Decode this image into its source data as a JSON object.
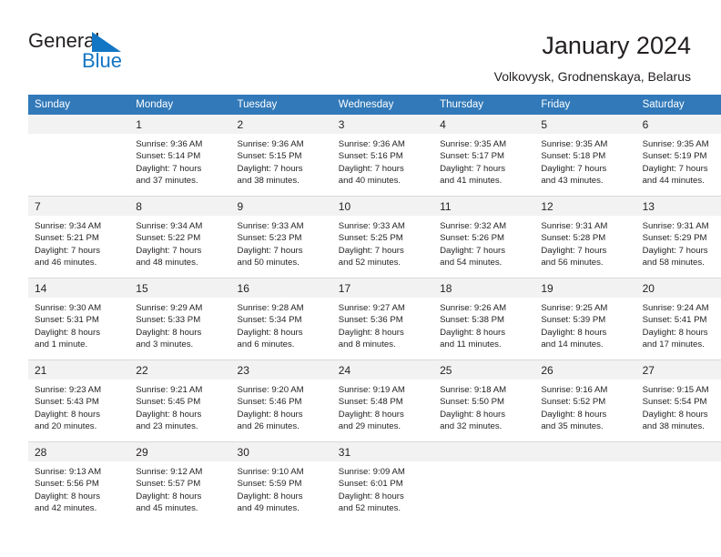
{
  "brand": {
    "name_part1": "General",
    "name_part2": "Blue",
    "logo_icon": "triangle-sail-icon",
    "accent_color": "#1376c4"
  },
  "header": {
    "title": "January 2024",
    "subtitle": "Volkovysk, Grodnenskaya, Belarus"
  },
  "colors": {
    "header_row_bg": "#3179b9",
    "daynum_bg": "#f2f2f2",
    "grid_line": "#d9d9d9",
    "text": "#231f20"
  },
  "weekday_headers": [
    "Sunday",
    "Monday",
    "Tuesday",
    "Wednesday",
    "Thursday",
    "Friday",
    "Saturday"
  ],
  "weeks": [
    [
      {
        "day": "",
        "empty": true,
        "sunrise": "",
        "sunset": "",
        "daylight_line1": "",
        "daylight_line2": ""
      },
      {
        "day": "1",
        "empty": false,
        "sunrise": "Sunrise: 9:36 AM",
        "sunset": "Sunset: 5:14 PM",
        "daylight_line1": "Daylight: 7 hours",
        "daylight_line2": "and 37 minutes."
      },
      {
        "day": "2",
        "empty": false,
        "sunrise": "Sunrise: 9:36 AM",
        "sunset": "Sunset: 5:15 PM",
        "daylight_line1": "Daylight: 7 hours",
        "daylight_line2": "and 38 minutes."
      },
      {
        "day": "3",
        "empty": false,
        "sunrise": "Sunrise: 9:36 AM",
        "sunset": "Sunset: 5:16 PM",
        "daylight_line1": "Daylight: 7 hours",
        "daylight_line2": "and 40 minutes."
      },
      {
        "day": "4",
        "empty": false,
        "sunrise": "Sunrise: 9:35 AM",
        "sunset": "Sunset: 5:17 PM",
        "daylight_line1": "Daylight: 7 hours",
        "daylight_line2": "and 41 minutes."
      },
      {
        "day": "5",
        "empty": false,
        "sunrise": "Sunrise: 9:35 AM",
        "sunset": "Sunset: 5:18 PM",
        "daylight_line1": "Daylight: 7 hours",
        "daylight_line2": "and 43 minutes."
      },
      {
        "day": "6",
        "empty": false,
        "sunrise": "Sunrise: 9:35 AM",
        "sunset": "Sunset: 5:19 PM",
        "daylight_line1": "Daylight: 7 hours",
        "daylight_line2": "and 44 minutes."
      }
    ],
    [
      {
        "day": "7",
        "empty": false,
        "sunrise": "Sunrise: 9:34 AM",
        "sunset": "Sunset: 5:21 PM",
        "daylight_line1": "Daylight: 7 hours",
        "daylight_line2": "and 46 minutes."
      },
      {
        "day": "8",
        "empty": false,
        "sunrise": "Sunrise: 9:34 AM",
        "sunset": "Sunset: 5:22 PM",
        "daylight_line1": "Daylight: 7 hours",
        "daylight_line2": "and 48 minutes."
      },
      {
        "day": "9",
        "empty": false,
        "sunrise": "Sunrise: 9:33 AM",
        "sunset": "Sunset: 5:23 PM",
        "daylight_line1": "Daylight: 7 hours",
        "daylight_line2": "and 50 minutes."
      },
      {
        "day": "10",
        "empty": false,
        "sunrise": "Sunrise: 9:33 AM",
        "sunset": "Sunset: 5:25 PM",
        "daylight_line1": "Daylight: 7 hours",
        "daylight_line2": "and 52 minutes."
      },
      {
        "day": "11",
        "empty": false,
        "sunrise": "Sunrise: 9:32 AM",
        "sunset": "Sunset: 5:26 PM",
        "daylight_line1": "Daylight: 7 hours",
        "daylight_line2": "and 54 minutes."
      },
      {
        "day": "12",
        "empty": false,
        "sunrise": "Sunrise: 9:31 AM",
        "sunset": "Sunset: 5:28 PM",
        "daylight_line1": "Daylight: 7 hours",
        "daylight_line2": "and 56 minutes."
      },
      {
        "day": "13",
        "empty": false,
        "sunrise": "Sunrise: 9:31 AM",
        "sunset": "Sunset: 5:29 PM",
        "daylight_line1": "Daylight: 7 hours",
        "daylight_line2": "and 58 minutes."
      }
    ],
    [
      {
        "day": "14",
        "empty": false,
        "sunrise": "Sunrise: 9:30 AM",
        "sunset": "Sunset: 5:31 PM",
        "daylight_line1": "Daylight: 8 hours",
        "daylight_line2": "and 1 minute."
      },
      {
        "day": "15",
        "empty": false,
        "sunrise": "Sunrise: 9:29 AM",
        "sunset": "Sunset: 5:33 PM",
        "daylight_line1": "Daylight: 8 hours",
        "daylight_line2": "and 3 minutes."
      },
      {
        "day": "16",
        "empty": false,
        "sunrise": "Sunrise: 9:28 AM",
        "sunset": "Sunset: 5:34 PM",
        "daylight_line1": "Daylight: 8 hours",
        "daylight_line2": "and 6 minutes."
      },
      {
        "day": "17",
        "empty": false,
        "sunrise": "Sunrise: 9:27 AM",
        "sunset": "Sunset: 5:36 PM",
        "daylight_line1": "Daylight: 8 hours",
        "daylight_line2": "and 8 minutes."
      },
      {
        "day": "18",
        "empty": false,
        "sunrise": "Sunrise: 9:26 AM",
        "sunset": "Sunset: 5:38 PM",
        "daylight_line1": "Daylight: 8 hours",
        "daylight_line2": "and 11 minutes."
      },
      {
        "day": "19",
        "empty": false,
        "sunrise": "Sunrise: 9:25 AM",
        "sunset": "Sunset: 5:39 PM",
        "daylight_line1": "Daylight: 8 hours",
        "daylight_line2": "and 14 minutes."
      },
      {
        "day": "20",
        "empty": false,
        "sunrise": "Sunrise: 9:24 AM",
        "sunset": "Sunset: 5:41 PM",
        "daylight_line1": "Daylight: 8 hours",
        "daylight_line2": "and 17 minutes."
      }
    ],
    [
      {
        "day": "21",
        "empty": false,
        "sunrise": "Sunrise: 9:23 AM",
        "sunset": "Sunset: 5:43 PM",
        "daylight_line1": "Daylight: 8 hours",
        "daylight_line2": "and 20 minutes."
      },
      {
        "day": "22",
        "empty": false,
        "sunrise": "Sunrise: 9:21 AM",
        "sunset": "Sunset: 5:45 PM",
        "daylight_line1": "Daylight: 8 hours",
        "daylight_line2": "and 23 minutes."
      },
      {
        "day": "23",
        "empty": false,
        "sunrise": "Sunrise: 9:20 AM",
        "sunset": "Sunset: 5:46 PM",
        "daylight_line1": "Daylight: 8 hours",
        "daylight_line2": "and 26 minutes."
      },
      {
        "day": "24",
        "empty": false,
        "sunrise": "Sunrise: 9:19 AM",
        "sunset": "Sunset: 5:48 PM",
        "daylight_line1": "Daylight: 8 hours",
        "daylight_line2": "and 29 minutes."
      },
      {
        "day": "25",
        "empty": false,
        "sunrise": "Sunrise: 9:18 AM",
        "sunset": "Sunset: 5:50 PM",
        "daylight_line1": "Daylight: 8 hours",
        "daylight_line2": "and 32 minutes."
      },
      {
        "day": "26",
        "empty": false,
        "sunrise": "Sunrise: 9:16 AM",
        "sunset": "Sunset: 5:52 PM",
        "daylight_line1": "Daylight: 8 hours",
        "daylight_line2": "and 35 minutes."
      },
      {
        "day": "27",
        "empty": false,
        "sunrise": "Sunrise: 9:15 AM",
        "sunset": "Sunset: 5:54 PM",
        "daylight_line1": "Daylight: 8 hours",
        "daylight_line2": "and 38 minutes."
      }
    ],
    [
      {
        "day": "28",
        "empty": false,
        "sunrise": "Sunrise: 9:13 AM",
        "sunset": "Sunset: 5:56 PM",
        "daylight_line1": "Daylight: 8 hours",
        "daylight_line2": "and 42 minutes."
      },
      {
        "day": "29",
        "empty": false,
        "sunrise": "Sunrise: 9:12 AM",
        "sunset": "Sunset: 5:57 PM",
        "daylight_line1": "Daylight: 8 hours",
        "daylight_line2": "and 45 minutes."
      },
      {
        "day": "30",
        "empty": false,
        "sunrise": "Sunrise: 9:10 AM",
        "sunset": "Sunset: 5:59 PM",
        "daylight_line1": "Daylight: 8 hours",
        "daylight_line2": "and 49 minutes."
      },
      {
        "day": "31",
        "empty": false,
        "sunrise": "Sunrise: 9:09 AM",
        "sunset": "Sunset: 6:01 PM",
        "daylight_line1": "Daylight: 8 hours",
        "daylight_line2": "and 52 minutes."
      },
      {
        "day": "",
        "empty": true,
        "sunrise": "",
        "sunset": "",
        "daylight_line1": "",
        "daylight_line2": ""
      },
      {
        "day": "",
        "empty": true,
        "sunrise": "",
        "sunset": "",
        "daylight_line1": "",
        "daylight_line2": ""
      },
      {
        "day": "",
        "empty": true,
        "sunrise": "",
        "sunset": "",
        "daylight_line1": "",
        "daylight_line2": ""
      }
    ]
  ]
}
